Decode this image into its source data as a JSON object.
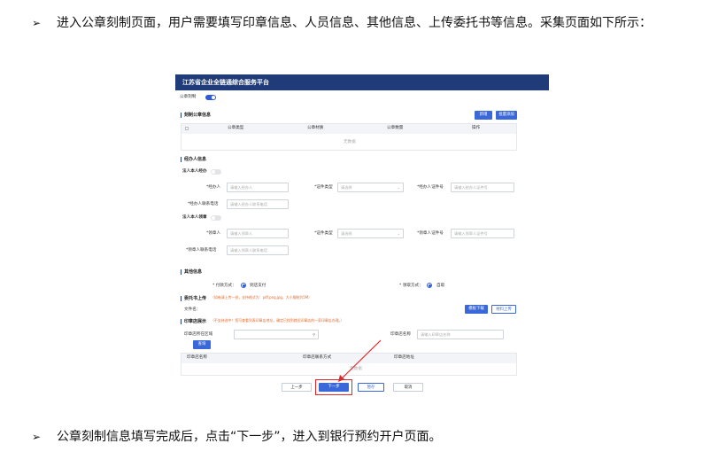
{
  "doc": {
    "para1": "进入公章刻制页面，用户需要填写印章信息、人员信息、其他信息、上传委托书等信息。采集页面如下所示：",
    "para2": "公章刻制信息填写完成后，点击“下一步”，进入到银行预约开户页面。",
    "bullet": "➢"
  },
  "screen": {
    "platform_title": "江苏省企业全链通综合服务平台",
    "gongzhang_toggle_label": "公章刻制",
    "seal_section": {
      "title": "刻制公章信息",
      "add_btn": "新增",
      "batch_add_btn": "批量添加",
      "columns": [
        "公章类型",
        "公章材质",
        "公章数量",
        "操作"
      ],
      "empty_text": "无数据"
    },
    "handler_section": {
      "title": "经办人信息",
      "legal_handle_label": "法人本人经办",
      "handler_label": "*经办人",
      "handler_placeholder": "请输入经办人",
      "id_type_label": "*证件类型",
      "id_type_placeholder": "请选择",
      "handler_id_label": "*经办人证件号",
      "handler_id_placeholder": "请输入经办人证件号",
      "handler_phone_label": "*经办人联系电话",
      "handler_phone_placeholder": "请输入经办人联系电话",
      "legal_pickup_label": "法人本人领章",
      "pickup_label": "*领章人",
      "pickup_placeholder": "请输入领章人",
      "id_type2_label": "*证件类型",
      "id_type2_placeholder": "请选择",
      "pickup_id_label": "*领章人证件号",
      "pickup_id_placeholder": "请输入领章人证件号",
      "pickup_phone_label": "*领章人联系电话",
      "pickup_phone_placeholder": "请输入领章人联系电话"
    },
    "other_section": {
      "title": "其他信息",
      "pay_label": "* 付款方式：",
      "pay_value": "到店支付",
      "receive_label": "* 领取方式：",
      "receive_value": "自取"
    },
    "upload_section": {
      "title": "委托书上传",
      "hint": "（如有请上传一份，支持格式为：pdf,png,jpg，大小限制为5M）",
      "file_label": "文件名：",
      "template_btn": "模板下载",
      "upload_btn": "材料上传"
    },
    "shop_section": {
      "title": "印章店展示",
      "hint": "（不支持选中！您可查看列表印章店地址，确定已找到就近印章店的一家印章店办理。）",
      "area_label": "印章店所在区域",
      "name_label": "印章店名称",
      "name_placeholder": "请输入印章店名称",
      "search_btn": "查询",
      "columns": [
        "印章店名称",
        "印章店联系方式",
        "印章店地址"
      ],
      "empty_text": "无数据"
    },
    "footer": {
      "prev_btn": "上一步",
      "next_btn": "下一步",
      "save_btn": "暂存",
      "cancel_btn": "取消"
    },
    "colors": {
      "header": "#1f3b78",
      "primary": "#3a68d8",
      "highlight": "#e0262a"
    }
  }
}
